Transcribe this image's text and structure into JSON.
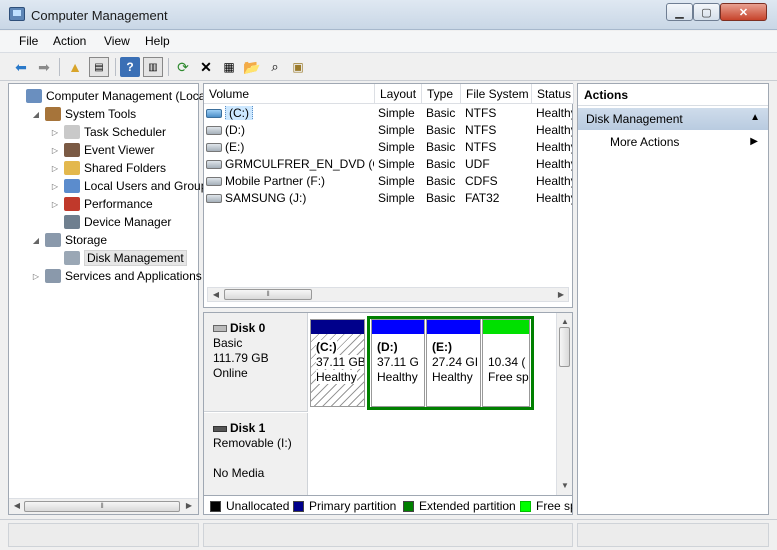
{
  "window": {
    "title": "Computer Management"
  },
  "menu": [
    "File",
    "Action",
    "View",
    "Help"
  ],
  "toolbar": [
    "back-icon",
    "forward-icon",
    "up-icon",
    "show-hide-tree-icon",
    "help-icon",
    "properties-pane-icon",
    "refresh-icon",
    "delete-icon",
    "properties-icon",
    "open-icon",
    "search-icon",
    "help-topic-icon"
  ],
  "tree": [
    {
      "label": "Computer Management (Local",
      "level": 0,
      "toggle": "",
      "icon": "computer-icon",
      "color": "#6a8fbf"
    },
    {
      "label": "System Tools",
      "level": 1,
      "toggle": "◢",
      "icon": "tools-icon",
      "color": "#a6743a"
    },
    {
      "label": "Task Scheduler",
      "level": 2,
      "toggle": "▷",
      "icon": "clock-icon",
      "color": "#c9c9c9"
    },
    {
      "label": "Event Viewer",
      "level": 2,
      "toggle": "▷",
      "icon": "event-icon",
      "color": "#7b5a44"
    },
    {
      "label": "Shared Folders",
      "level": 2,
      "toggle": "▷",
      "icon": "folder-icon",
      "color": "#e3b84d"
    },
    {
      "label": "Local Users and Groups",
      "level": 2,
      "toggle": "▷",
      "icon": "users-icon",
      "color": "#5b8ccd"
    },
    {
      "label": "Performance",
      "level": 2,
      "toggle": "▷",
      "icon": "performance-icon",
      "color": "#c0392b"
    },
    {
      "label": "Device Manager",
      "level": 2,
      "toggle": "",
      "icon": "device-icon",
      "color": "#6f7f8f"
    },
    {
      "label": "Storage",
      "level": 1,
      "toggle": "◢",
      "icon": "storage-icon",
      "color": "#8a99ab"
    },
    {
      "label": "Disk Management",
      "level": 2,
      "toggle": "",
      "icon": "disk-icon",
      "color": "#9aa7b5",
      "selected": true
    },
    {
      "label": "Services and Applications",
      "level": 1,
      "toggle": "▷",
      "icon": "services-icon",
      "color": "#8a99ab"
    }
  ],
  "volumes": {
    "columns": [
      "Volume",
      "Layout",
      "Type",
      "File System",
      "Status"
    ],
    "rows": [
      {
        "volume": "(C:)",
        "layout": "Simple",
        "type": "Basic",
        "fs": "NTFS",
        "status": "Healthy",
        "selected": true
      },
      {
        "volume": "(D:)",
        "layout": "Simple",
        "type": "Basic",
        "fs": "NTFS",
        "status": "Healthy"
      },
      {
        "volume": "(E:)",
        "layout": "Simple",
        "type": "Basic",
        "fs": "NTFS",
        "status": "Healthy"
      },
      {
        "volume": "GRMCULFRER_EN_DVD (G:)",
        "layout": "Simple",
        "type": "Basic",
        "fs": "UDF",
        "status": "Healthy"
      },
      {
        "volume": "Mobile Partner (F:)",
        "layout": "Simple",
        "type": "Basic",
        "fs": "CDFS",
        "status": "Healthy"
      },
      {
        "volume": "SAMSUNG (J:)",
        "layout": "Simple",
        "type": "Basic",
        "fs": "FAT32",
        "status": "Healthy"
      }
    ]
  },
  "disks": [
    {
      "name": "Disk 0",
      "lines": [
        "Basic",
        "111.79 GB",
        "Online"
      ],
      "partitions": [
        {
          "label": "(C:)",
          "size": "37.11 GB",
          "status": "Healthy",
          "kind": "primary",
          "hatched": true
        },
        {
          "label": "(D:)",
          "size": "37.11 G",
          "status": "Healthy",
          "kind": "primary"
        },
        {
          "label": "(E:)",
          "size": "27.24 GI",
          "status": "Healthy",
          "kind": "primary"
        },
        {
          "label": "",
          "size": "10.34 (",
          "status": "Free sp",
          "kind": "free"
        }
      ]
    },
    {
      "name": "Disk 1",
      "lines": [
        "Removable (I:)",
        "",
        "No Media"
      ],
      "partitions": []
    }
  ],
  "legend": [
    {
      "label": "Unallocated",
      "color": "#000000"
    },
    {
      "label": "Primary partition",
      "color": "#00008b"
    },
    {
      "label": "Extended partition",
      "color": "#008000"
    },
    {
      "label": "Free sp",
      "color": "#00ff00"
    }
  ],
  "actions": {
    "header": "Actions",
    "section": "Disk Management",
    "more": "More Actions"
  },
  "colors": {
    "primary_bar": "#0000ff",
    "dark_bar": "#00008b",
    "free_bar": "#00e000",
    "extended_border": "#008000"
  }
}
